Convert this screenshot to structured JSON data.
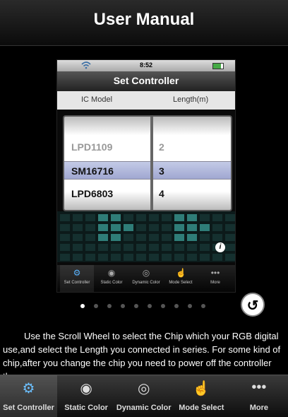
{
  "header": {
    "title": "User Manual"
  },
  "phone": {
    "status": {
      "time": "8:52"
    },
    "nav_title": "Set Controller",
    "columns": {
      "ic_model": "IC Model",
      "length": "Length(m)"
    },
    "picker_rows": [
      {
        "model": "LPD1109",
        "length": "2",
        "faded": true
      },
      {
        "model": "SM16716",
        "length": "3",
        "faded": false
      },
      {
        "model": "LPD6803",
        "length": "4",
        "faded": false
      }
    ],
    "info_label": "i",
    "mini_tabs": [
      {
        "label": "Set Controller",
        "icon": "gear-icon",
        "glyph": "⚙",
        "active": true
      },
      {
        "label": "Static Color",
        "icon": "eye-icon",
        "glyph": "◉",
        "active": false
      },
      {
        "label": "Dynamic Color",
        "icon": "eye-ring-icon",
        "glyph": "◎",
        "active": false
      },
      {
        "label": "Mode Select",
        "icon": "hand-icon",
        "glyph": "☝",
        "active": false
      },
      {
        "label": "More",
        "icon": "more-dots-icon",
        "glyph": "•••",
        "active": false
      }
    ]
  },
  "pagination": {
    "count": 10,
    "active_index": 0
  },
  "back_button": {
    "icon": "return-arrow-icon",
    "glyph": "↺"
  },
  "description": "Use the Scroll Wheel to select the Chip which your RGB digital use,and select the Length you connected in series. For some kind of chip,after you change the chip you need to power off the controller then power on",
  "tabbar": [
    {
      "label": "Set Controller",
      "icon": "gear-icon",
      "glyph": "⚙",
      "active": true
    },
    {
      "label": "Static Color",
      "icon": "eye-icon",
      "glyph": "◉",
      "active": false
    },
    {
      "label": "Dynamic Color",
      "icon": "eye-ring-icon",
      "glyph": "◎",
      "active": false
    },
    {
      "label": "Mode Select",
      "icon": "hand-icon",
      "glyph": "☝",
      "active": false
    },
    {
      "label": "More",
      "icon": "more-dots-icon",
      "glyph": "•••",
      "active": false
    }
  ]
}
